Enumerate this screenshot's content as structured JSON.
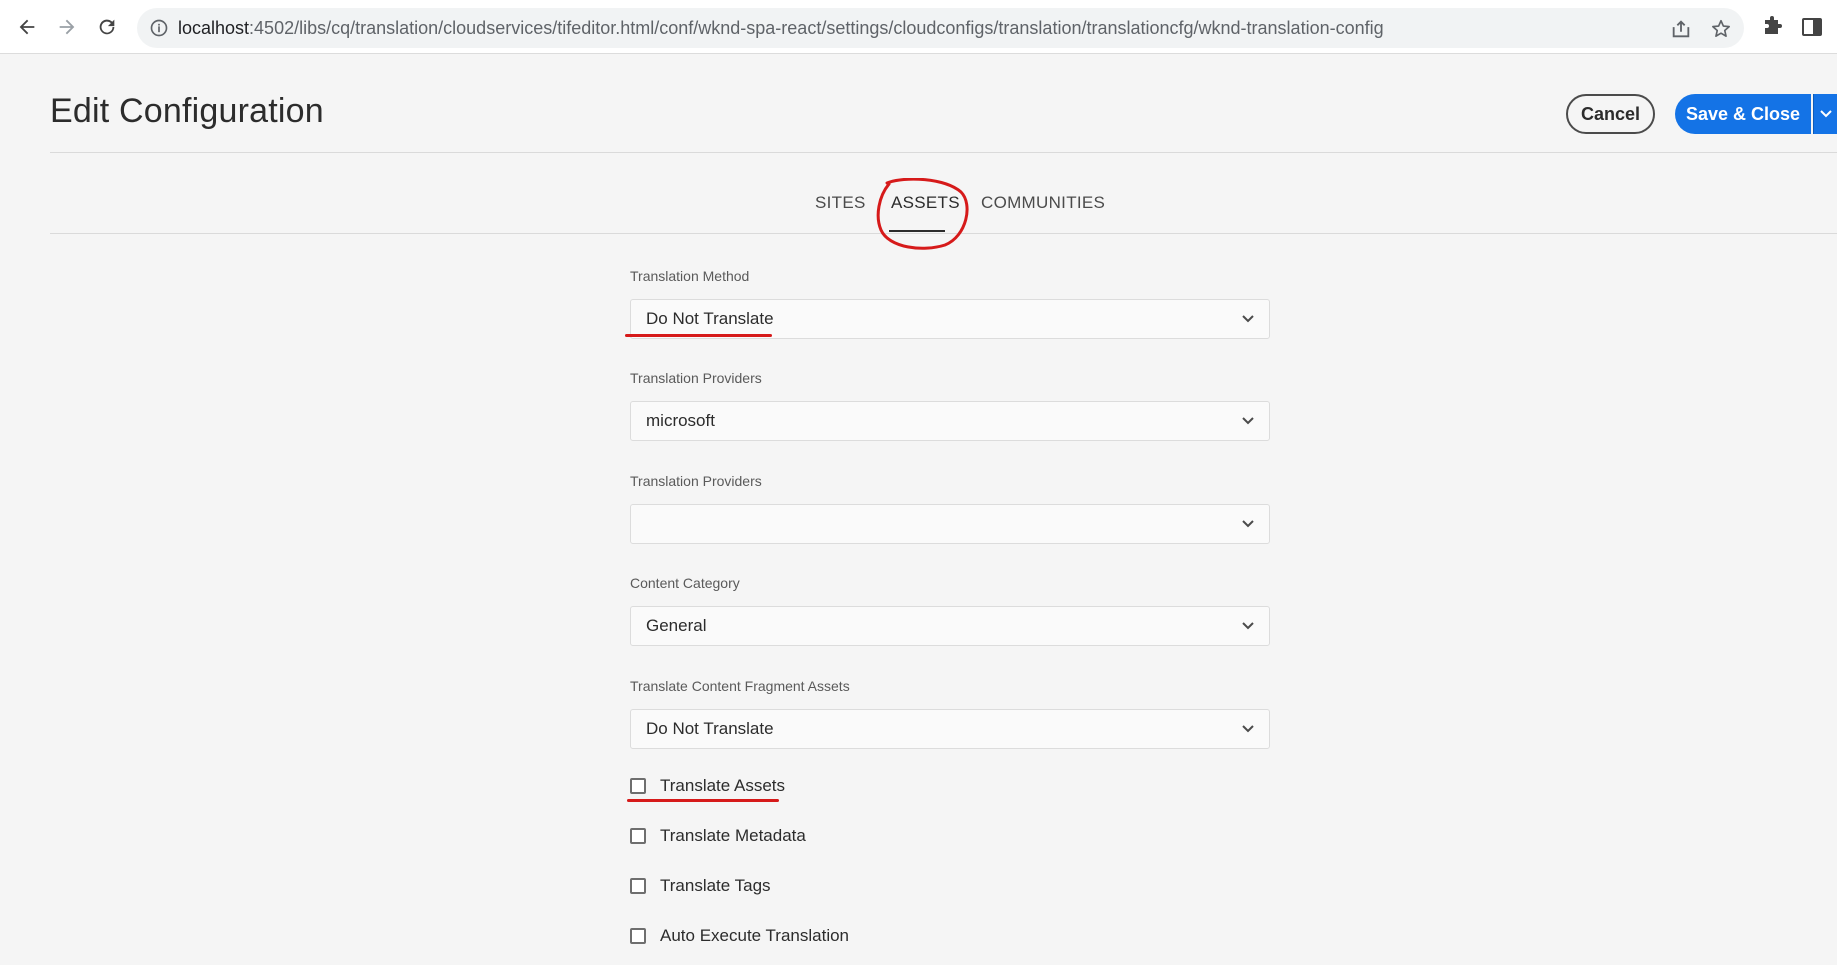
{
  "browser": {
    "url_host": "localhost",
    "url_rest": ":4502/libs/cq/translation/cloudservices/tifeditor.html/conf/wknd-spa-react/settings/cloudconfigs/translation/translationcfg/wknd-translation-config"
  },
  "header": {
    "title": "Edit Configuration",
    "cancel_label": "Cancel",
    "save_label": "Save & Close"
  },
  "tabs": [
    {
      "label": "SITES",
      "active": false
    },
    {
      "label": "ASSETS",
      "active": true
    },
    {
      "label": "COMMUNITIES",
      "active": false
    }
  ],
  "form": {
    "translation_method": {
      "label": "Translation Method",
      "value": "Do Not Translate"
    },
    "translation_providers": {
      "label": "Translation Providers",
      "value": "microsoft"
    },
    "translation_providers_2": {
      "label": "Translation Providers",
      "value": ""
    },
    "content_category": {
      "label": "Content Category",
      "value": "General"
    },
    "content_fragment_assets": {
      "label": "Translate Content Fragment Assets",
      "value": "Do Not Translate"
    },
    "checkboxes": [
      {
        "label": "Translate Assets",
        "checked": false
      },
      {
        "label": "Translate Metadata",
        "checked": false
      },
      {
        "label": "Translate Tags",
        "checked": false
      },
      {
        "label": "Auto Execute Translation",
        "checked": false
      }
    ]
  },
  "colors": {
    "accent": "#1473e6",
    "annotation": "#d61a1a"
  }
}
